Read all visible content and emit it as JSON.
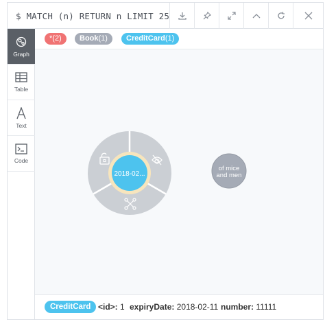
{
  "query": "$ MATCH (n) RETURN n LIMIT 25",
  "header_buttons": [
    {
      "name": "download-icon"
    },
    {
      "name": "pin-icon"
    },
    {
      "name": "expand-icon"
    },
    {
      "name": "collapse-icon"
    },
    {
      "name": "refresh-icon"
    },
    {
      "name": "close-icon"
    }
  ],
  "sidebar": {
    "items": [
      {
        "label": "Graph",
        "icon": "graph-icon",
        "active": true
      },
      {
        "label": "Table",
        "icon": "table-icon",
        "active": false
      },
      {
        "label": "Text",
        "icon": "text-icon",
        "active": false
      },
      {
        "label": "Code",
        "icon": "code-icon",
        "active": false
      }
    ]
  },
  "legend": {
    "all": {
      "label": "*",
      "count": "(2)",
      "color": "#f07373"
    },
    "book": {
      "label": "Book",
      "count": "(1)",
      "color": "#a5abb6"
    },
    "creditcard": {
      "label": "CreditCard",
      "count": "(1)",
      "color": "#4dc3ee"
    }
  },
  "graph": {
    "selected_node": {
      "caption": "2018-02...",
      "color": "#4dc3ee",
      "ring_color": "#f7e5bd"
    },
    "other_node": {
      "caption_line1": "of mice",
      "caption_line2": "and men",
      "color": "#a5abb6"
    },
    "ring_actions": [
      "unlock-icon",
      "hide-eye-icon",
      "expand-relationships-icon"
    ]
  },
  "footer": {
    "label": "CreditCard",
    "props": {
      "id_key": "<id>:",
      "id_val": "1",
      "expiry_key": "expiryDate:",
      "expiry_val": "2018-02-11",
      "number_key": "number:",
      "number_val": "11111"
    }
  }
}
